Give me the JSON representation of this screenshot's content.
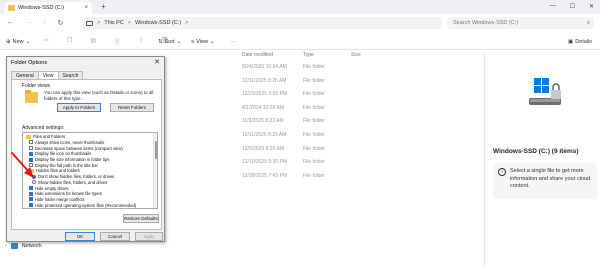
{
  "window": {
    "tab_title": "Windows-SSD (C:)",
    "new_tab": "+",
    "close_tab": "×",
    "controls": [
      "—",
      "☐",
      "✕"
    ]
  },
  "address_bar": {
    "crumbs": [
      "This PC",
      "Windows-SSD (C:)"
    ],
    "separator": ">",
    "search_placeholder": "Search Windows-SSD (C:)"
  },
  "command_bar": {
    "new_label": "New",
    "sort_label": "Sort",
    "view_label": "View",
    "more_label": "···",
    "details_label": "Details"
  },
  "file_list": {
    "headers": {
      "modified": "Date modified",
      "type": "Type",
      "size": "Size"
    },
    "rows": [
      {
        "modified": "8/24/2025 10:04 AM",
        "type": "File folder"
      },
      {
        "modified": "12/11/2025 8:26 AM",
        "type": "File folder"
      },
      {
        "modified": "12/23/2025 3:03 PM",
        "type": "File folder"
      },
      {
        "modified": "4/1/2024 10:26 AM",
        "type": "File folder"
      },
      {
        "modified": "11/3/2025 8:22 AM",
        "type": "File folder"
      },
      {
        "modified": "12/11/2025 8:29 AM",
        "type": "File folder"
      },
      {
        "modified": "12/9/2025 8:26 AM",
        "type": "File folder"
      },
      {
        "modified": "12/10/2025 9:30 PM",
        "type": "File folder"
      },
      {
        "modified": "12/28/2025 7:43 PM",
        "type": "File folder"
      }
    ]
  },
  "sidebar": {
    "network_label": "Network"
  },
  "details_pane": {
    "title": "Windows-SSD (C:) (9 items)",
    "info_text": "Select a single file to get more information and share your cloud content."
  },
  "dialog": {
    "title": "Folder Options",
    "close": "✕",
    "tabs": [
      "General",
      "View",
      "Search"
    ],
    "active_tab": "View",
    "folder_views_label": "Folder views",
    "folder_views_text": "You can apply this view (such as Details or Icons) to all folders of this type.",
    "apply_to_folders": "Apply to Folders",
    "reset_folders": "Reset Folders",
    "advanced_label": "Advanced settings:",
    "advanced_items": [
      {
        "label": "Files and Folders",
        "kind": "folder",
        "indent": 0
      },
      {
        "label": "Always show icons, never thumbnails",
        "kind": "checkbox",
        "checked": false,
        "indent": 1
      },
      {
        "label": "Decrease space between items (compact view)",
        "kind": "checkbox",
        "checked": false,
        "indent": 1
      },
      {
        "label": "Display file icon on thumbnails",
        "kind": "checkbox",
        "checked": true,
        "indent": 1
      },
      {
        "label": "Display file size information in folder tips",
        "kind": "checkbox",
        "checked": true,
        "indent": 1
      },
      {
        "label": "Display the full path in the title bar",
        "kind": "checkbox",
        "checked": false,
        "indent": 1
      },
      {
        "label": "Hidden files and folders",
        "kind": "folder",
        "indent": 1
      },
      {
        "label": "Don't show hidden files, folders, or drives",
        "kind": "radio",
        "checked": true,
        "indent": 2
      },
      {
        "label": "Show hidden files, folders, and drives",
        "kind": "radio",
        "checked": false,
        "indent": 2
      },
      {
        "label": "Hide empty drives",
        "kind": "checkbox",
        "checked": true,
        "indent": 1
      },
      {
        "label": "Hide extensions for known file types",
        "kind": "checkbox",
        "checked": true,
        "indent": 1
      },
      {
        "label": "Hide folder merge conflicts",
        "kind": "checkbox",
        "checked": true,
        "indent": 1
      },
      {
        "label": "Hide protected operating system files (Recommended)",
        "kind": "checkbox",
        "checked": true,
        "indent": 1
      }
    ],
    "restore_defaults": "Restore Defaults",
    "ok": "OK",
    "cancel": "Cancel",
    "apply": "Apply"
  },
  "colors": {
    "accent": "#2f6fd1",
    "annotation_arrow": "#e0161b",
    "folder": "#f2c14e"
  }
}
